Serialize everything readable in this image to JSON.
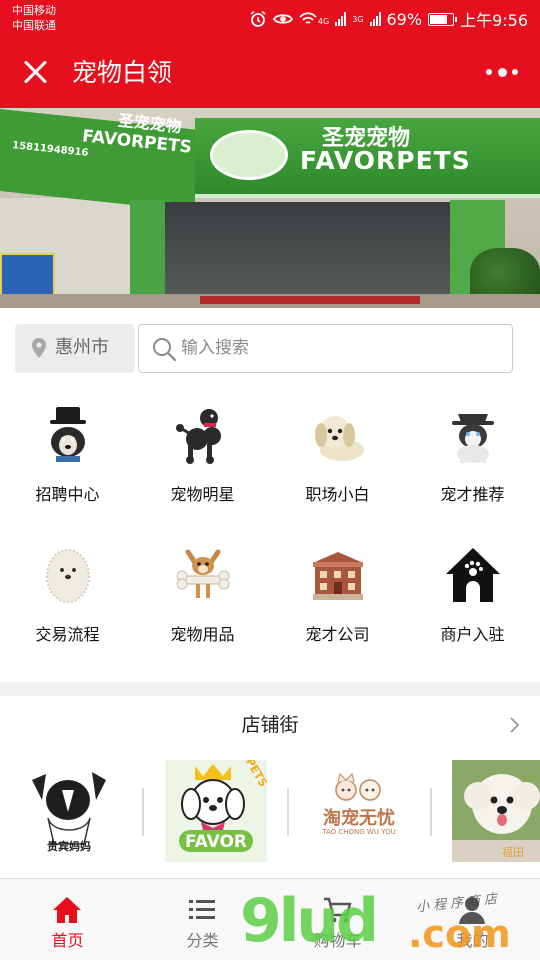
{
  "status_bar": {
    "carrier_1": "中国移动",
    "carrier_2": "中国联通",
    "network_1": "4G",
    "network_2": "3G",
    "battery": "69%",
    "time": "上午9:56",
    "icons": [
      "alarm-icon",
      "eye-icon",
      "wifi-icon",
      "signal-icon",
      "battery-icon"
    ]
  },
  "header": {
    "title": "宠物白领",
    "bg_color": "#e60f1e"
  },
  "banner": {
    "sign_cn": "圣宠宠物",
    "sign_en": "FAVORPETS",
    "sign_small_cn": "圣宠宠物",
    "sign_small_en": "FAVORPETS",
    "phone": "15811948916"
  },
  "search": {
    "city": "惠州市",
    "placeholder": "输入搜索"
  },
  "menu": [
    {
      "label": "招聘中心",
      "icon": "dog-top-hat-icon"
    },
    {
      "label": "宠物明星",
      "icon": "poodle-icon"
    },
    {
      "label": "职场小白",
      "icon": "puppy-icon"
    },
    {
      "label": "宠才推荐",
      "icon": "husky-icon"
    },
    {
      "label": "交易流程",
      "icon": "fluffy-dog-icon"
    },
    {
      "label": "宠物用品",
      "icon": "chihuahua-bone-icon"
    },
    {
      "label": "宠才公司",
      "icon": "building-icon"
    },
    {
      "label": "商户入驻",
      "icon": "pet-house-icon"
    }
  ],
  "shop_street": {
    "title": "店铺街",
    "shops": [
      {
        "name": "贵宾妈妈"
      },
      {
        "name": "FAVOR",
        "badge": "PETS"
      },
      {
        "name": "淘宠无忧",
        "sub": "TAO CHONG WU YOU"
      },
      {
        "name": "福田"
      }
    ]
  },
  "tabbar": {
    "active_color": "#e60f1e",
    "tabs": [
      {
        "label": "首页",
        "icon": "home-icon",
        "active": true
      },
      {
        "label": "分类",
        "icon": "list-icon",
        "active": false
      },
      {
        "label": "购物车",
        "icon": "cart-icon",
        "active": false
      },
      {
        "label": "我的",
        "icon": "user-icon",
        "active": false
      }
    ]
  },
  "watermark": {
    "main": "9lud",
    "com": ".com",
    "small": "小程序商店"
  }
}
